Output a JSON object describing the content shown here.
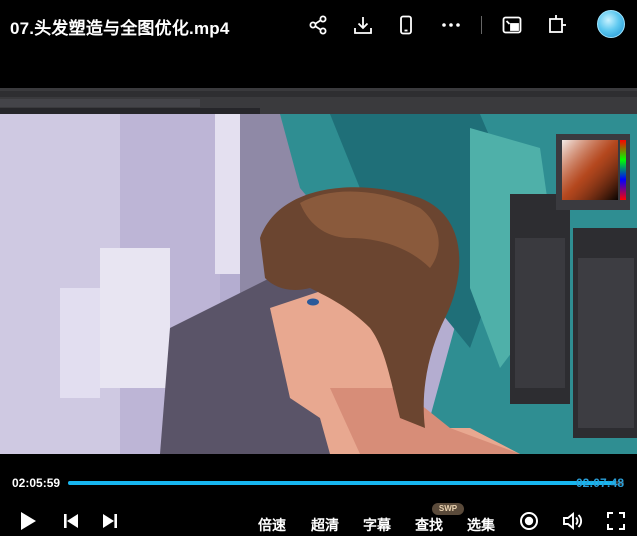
{
  "header": {
    "title": "07.头发塑造与全图优化.mp4"
  },
  "player": {
    "current_time": "02:05:59",
    "end_time": "02:07:48",
    "progress": 0.985
  },
  "controls": {
    "speed_label": "倍速",
    "quality_label": "超清",
    "subtitle_label": "字幕",
    "search_label": "查找",
    "search_badge": "SWP",
    "episodes_label": "选集"
  },
  "colors": {
    "accent": "#17b6ef",
    "background": "#000000"
  }
}
